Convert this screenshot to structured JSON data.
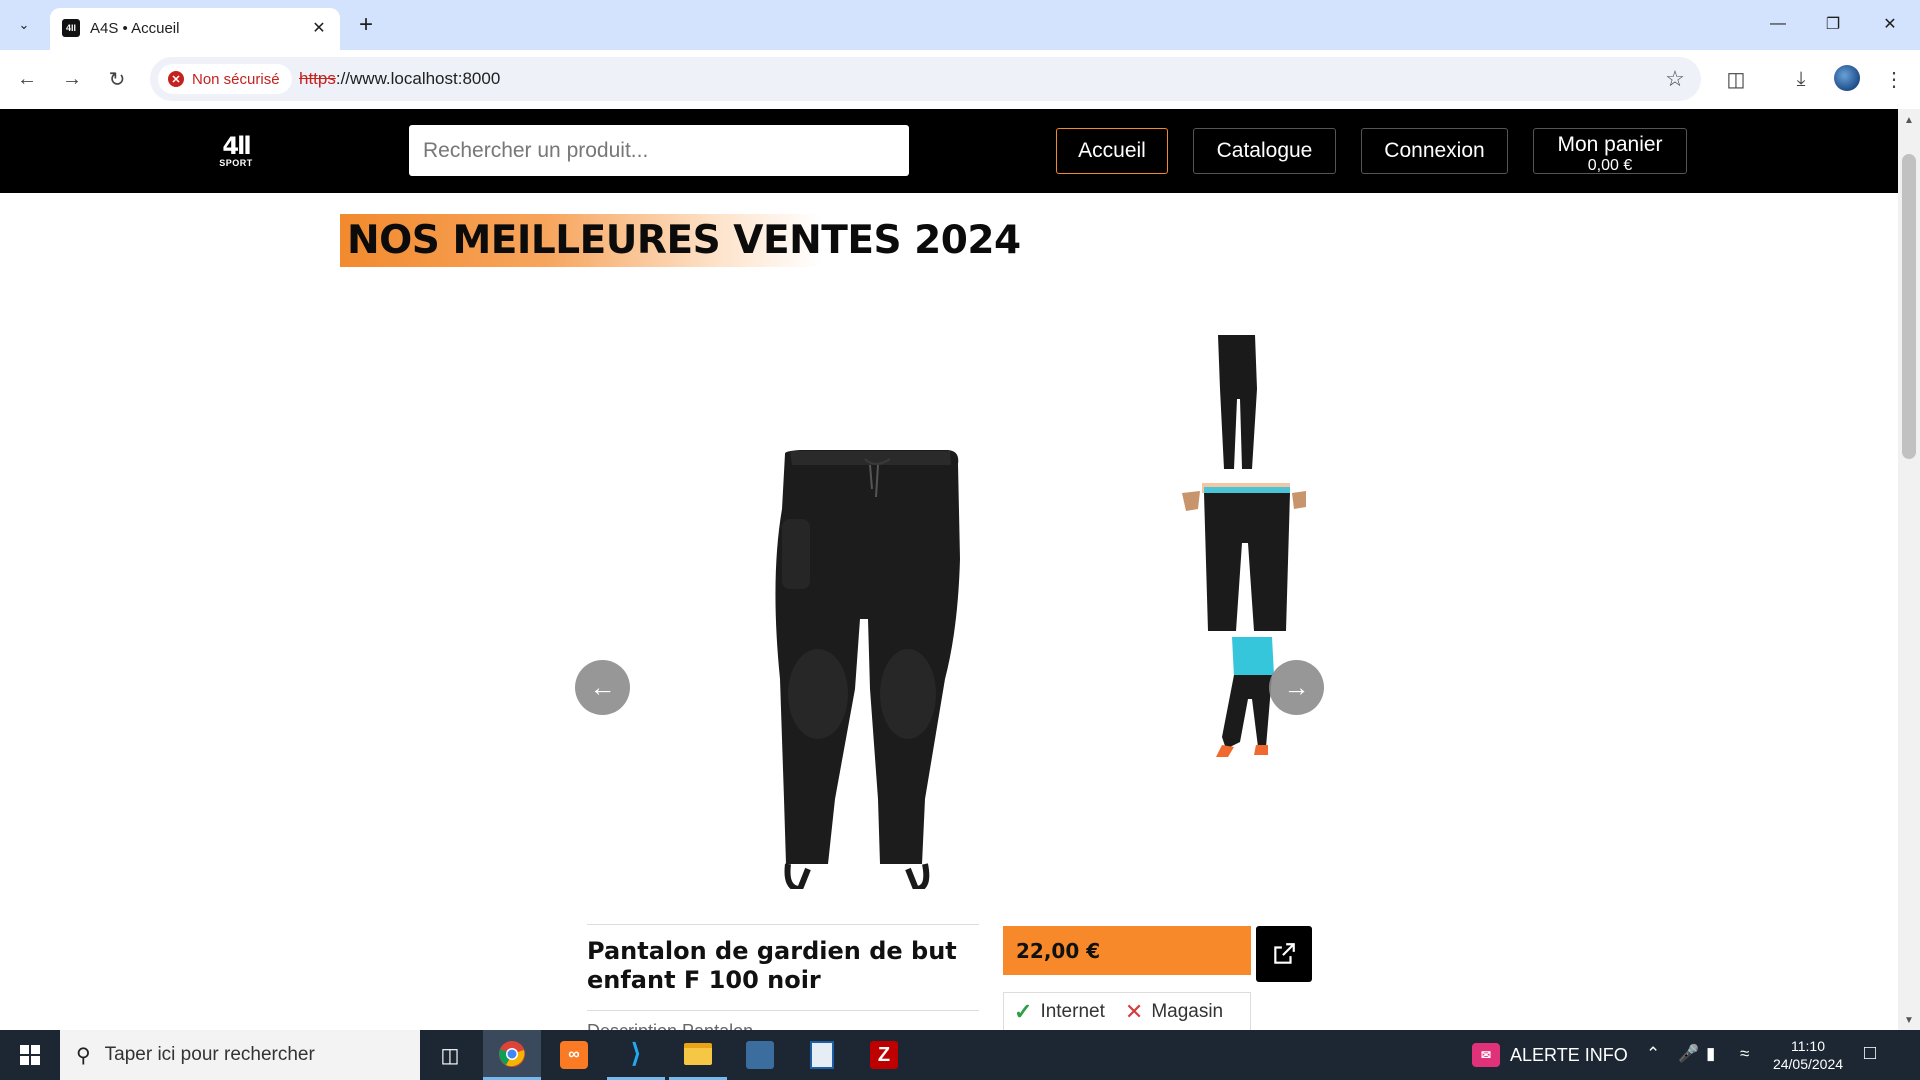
{
  "browser": {
    "tab_title": "A4S • Accueil",
    "favicon_text": "4ll",
    "security_label": "Non sécurisé",
    "url_scheme": "https",
    "url_rest": "://www.localhost:8000"
  },
  "site": {
    "logo_mark": "4ll",
    "logo_sub": "SPORT",
    "search_placeholder": "Rechercher un produit...",
    "nav": {
      "home": "Accueil",
      "catalog": "Catalogue",
      "login": "Connexion",
      "cart": "Mon panier",
      "cart_total": "0,00 €"
    },
    "section_title": "NOS MEILLEURES VENTES 2024"
  },
  "product": {
    "name": "Pantalon de gardien de but enfant F 100 noir",
    "description_preview": "Description Pantalon",
    "price": "22,00 €",
    "availability": [
      {
        "label": "Internet",
        "available": true
      },
      {
        "label": "Magasin",
        "available": false
      }
    ]
  },
  "taskbar": {
    "search_placeholder": "Taper ici pour rechercher",
    "alert_label": "ALERTE INFO",
    "time": "11:10",
    "date": "24/05/2024"
  },
  "colors": {
    "accent": "#f7892a",
    "header_bg": "#000000",
    "insecure": "#c5221f"
  }
}
